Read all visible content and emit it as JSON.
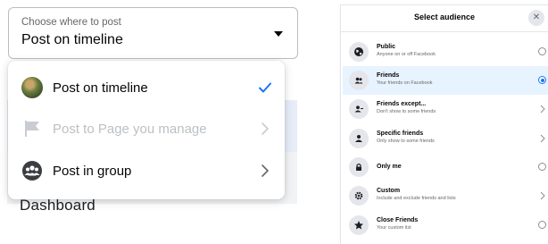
{
  "post_location": {
    "label": "Choose where to post",
    "value": "Post on timeline",
    "options": [
      {
        "label": "Post on timeline",
        "icon": "profile-avatar-icon",
        "state": "selected"
      },
      {
        "label": "Post to Page you manage",
        "icon": "flag-icon",
        "state": "disabled"
      },
      {
        "label": "Post in group",
        "icon": "group-icon",
        "state": "enabled"
      }
    ],
    "background_text": "Dashboard"
  },
  "audience": {
    "title": "Select audience",
    "close_symbol": "✕",
    "options": [
      {
        "title": "Public",
        "subtitle": "Anyone on or off Facebook",
        "icon": "globe-icon",
        "control": "radio",
        "selected": false
      },
      {
        "title": "Friends",
        "subtitle": "Your friends on Facebook",
        "icon": "friends-icon",
        "control": "radio",
        "selected": true
      },
      {
        "title": "Friends except...",
        "subtitle": "Don't show to some friends",
        "icon": "friend-minus-icon",
        "control": "chevron",
        "selected": false
      },
      {
        "title": "Specific friends",
        "subtitle": "Only show to some friends",
        "icon": "person-icon",
        "control": "chevron",
        "selected": false
      },
      {
        "title": "Only me",
        "subtitle": "",
        "icon": "lock-icon",
        "control": "radio",
        "selected": false
      },
      {
        "title": "Custom",
        "subtitle": "Include and exclude friends and lists",
        "icon": "gear-icon",
        "control": "chevron",
        "selected": false
      },
      {
        "title": "Close Friends",
        "subtitle": "Your custom list",
        "icon": "star-icon",
        "control": "radio",
        "selected": false
      }
    ]
  },
  "colors": {
    "accent": "#1877f2",
    "selected_row": "#e7f3ff",
    "disabled_text": "#bcc0c4",
    "secondary_text": "#65676b"
  }
}
